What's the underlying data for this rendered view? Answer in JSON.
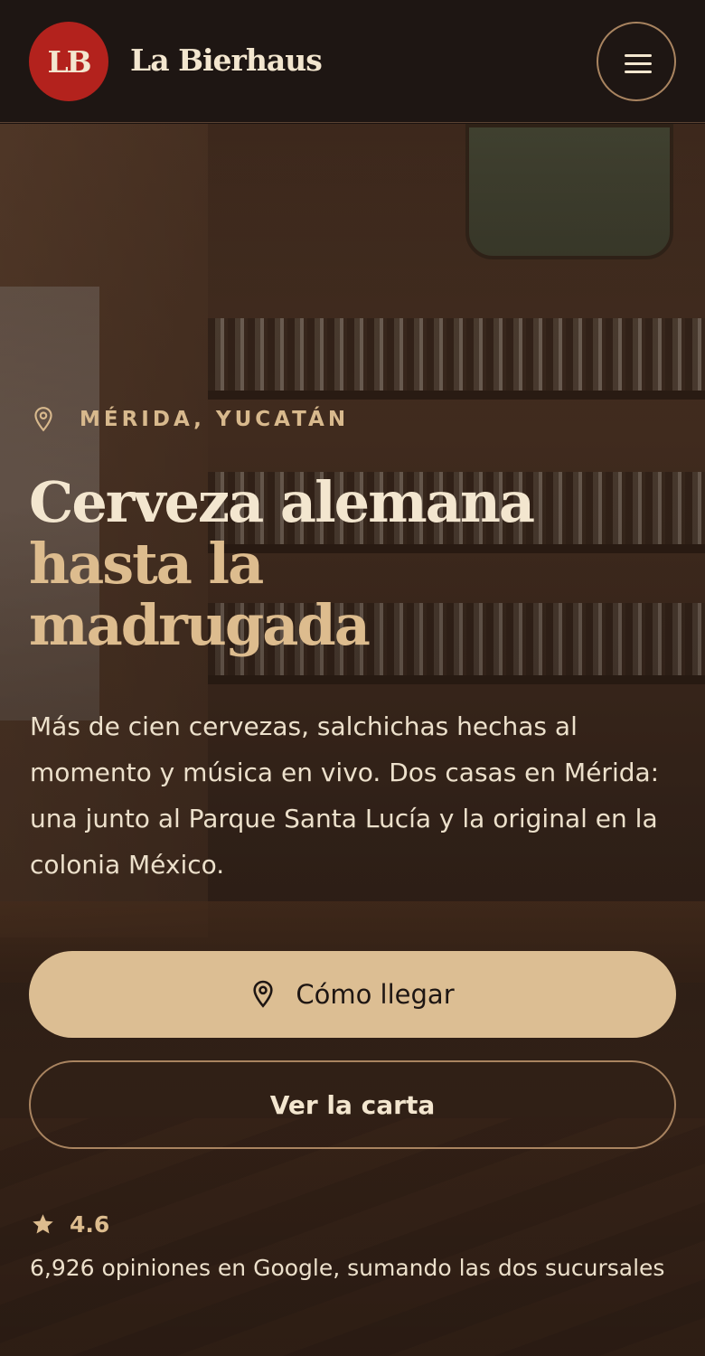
{
  "header": {
    "logo_text": "LB",
    "brand_name": "La Bierhaus",
    "menu_icon": "hamburger-menu-icon"
  },
  "hero": {
    "location_icon": "map-pin-icon",
    "location": "MÉRIDA, YUCATÁN",
    "headline_line1": "Cerveza alemana",
    "headline_line2": "hasta la",
    "headline_line3": "madrugada",
    "description": "Más de cien cervezas, salchichas hechas al momento y música en vivo. Dos casas en Mérida: una junto al Parque Santa Lucía y la original en la colonia México.",
    "primary_button": {
      "icon": "map-pin-icon",
      "label": "Cómo llegar"
    },
    "secondary_button": {
      "label": "Ver la carta"
    },
    "rating": {
      "icon": "star-icon",
      "value": "4.6"
    },
    "reviews_text": "6,926 opiniones en Google, sumando las dos sucursales"
  },
  "colors": {
    "header_bg": "#1e1613",
    "logo_red": "#b3221d",
    "cream": "#f3e6cf",
    "tan": "#dcbe93",
    "accent_border": "#a98460"
  }
}
